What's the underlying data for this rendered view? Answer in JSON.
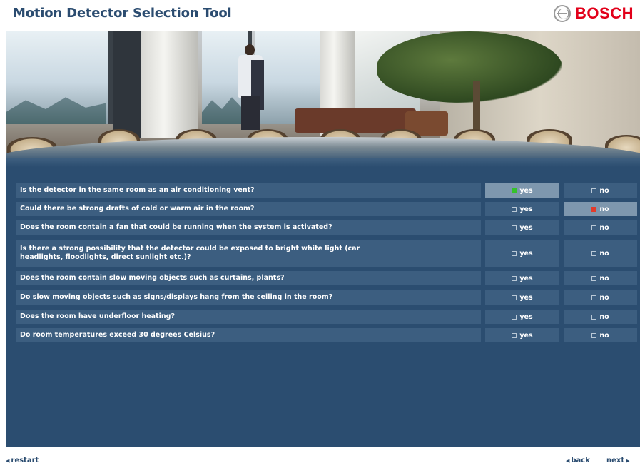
{
  "header": {
    "title": "Motion Detector Selection Tool",
    "logo_text": "BOSCH"
  },
  "questions": [
    {
      "text": "Is the detector in the same room as an air conditioning vent?",
      "yes_label": "yes",
      "no_label": "no",
      "answer": "yes"
    },
    {
      "text": "Could there be strong drafts of cold or warm air in the room?",
      "yes_label": "yes",
      "no_label": "no",
      "answer": "no"
    },
    {
      "text": "Does the room contain a fan that could be running when the system is activated?",
      "yes_label": "yes",
      "no_label": "no",
      "answer": ""
    },
    {
      "text": "Is there a strong possibility that the detector could be exposed to bright white light (car headlights, floodlights, direct sunlight etc.)?",
      "yes_label": "yes",
      "no_label": "no",
      "answer": ""
    },
    {
      "text": "Does the room contain slow moving objects such as curtains, plants?",
      "yes_label": "yes",
      "no_label": "no",
      "answer": ""
    },
    {
      "text": "Do slow moving objects such as signs/displays hang from the ceiling in the room?",
      "yes_label": "yes",
      "no_label": "no",
      "answer": ""
    },
    {
      "text": "Does the room have underfloor heating?",
      "yes_label": "yes",
      "no_label": "no",
      "answer": ""
    },
    {
      "text": "Do room temperatures exceed 30 degrees Celsius?",
      "yes_label": "yes",
      "no_label": "no",
      "answer": ""
    }
  ],
  "footer": {
    "restart_label": "restart",
    "back_label": "back",
    "next_label": "next"
  },
  "colors": {
    "title": "#2b4c70",
    "brand": "#e2001a",
    "panel": "#2b4d70",
    "row": "#3c5e80",
    "selected": "#7e97ae",
    "yes_mark": "#34c22a",
    "no_mark": "#e23a2a"
  }
}
